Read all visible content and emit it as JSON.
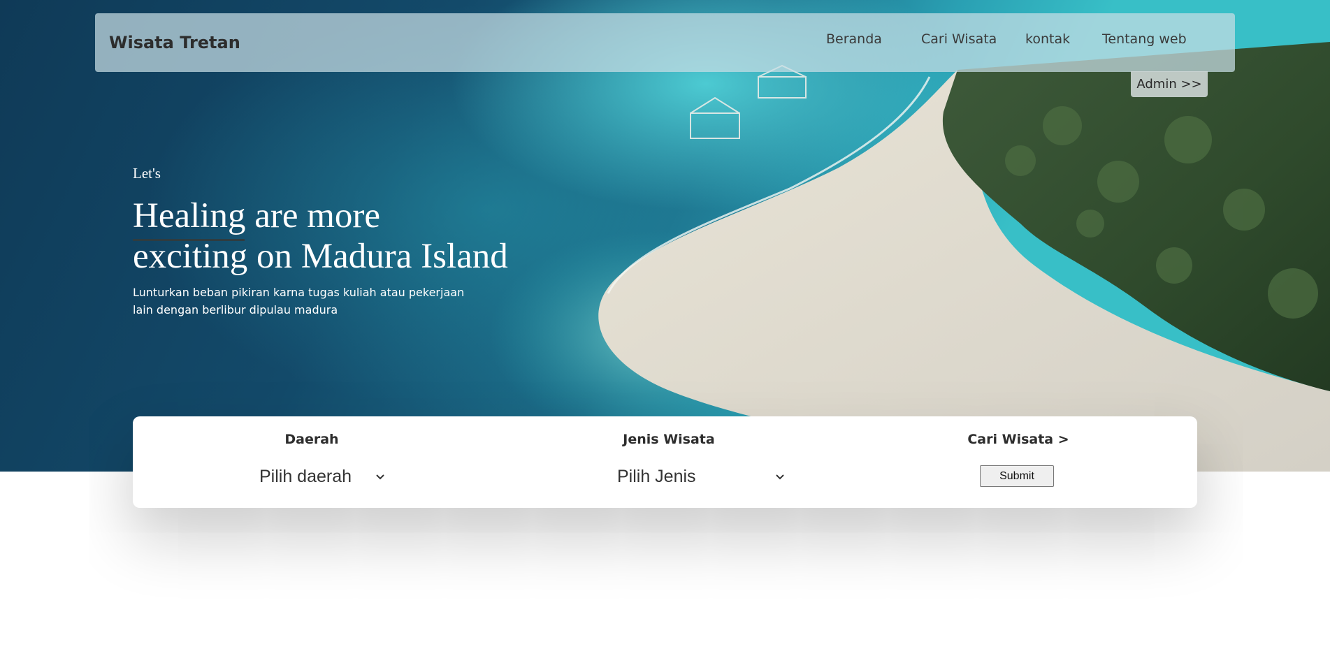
{
  "navbar": {
    "brand": "Wisata Tretan",
    "links": [
      "Beranda",
      "Cari Wisata",
      "kontak",
      "Tentang web"
    ],
    "admin_label": "Admin >>"
  },
  "hero": {
    "kicker": "Let's",
    "headline_emphasis": "Healing",
    "headline_rest_line1": " are more",
    "headline_line2": "exciting on Madura Island",
    "subtext_line1": "Lunturkan beban pikiran karna tugas kuliah atau pekerjaan",
    "subtext_line2": "lain dengan berlibur dipulau madura"
  },
  "search": {
    "daerah_title": "Daerah",
    "daerah_selected": "Pilih daerah",
    "jenis_title": "Jenis Wisata",
    "jenis_selected": "Pilih Jenis",
    "cari_title": "Cari Wisata >",
    "submit_label": "Submit"
  },
  "colors": {
    "brand_text": "#2d2d2d",
    "hero_text": "#ffffff",
    "card_bg": "#ffffff",
    "navbar_bg": "rgba(200,222,228,0.72)"
  },
  "icons": {
    "select_chevron": "chevron-down-icon"
  }
}
